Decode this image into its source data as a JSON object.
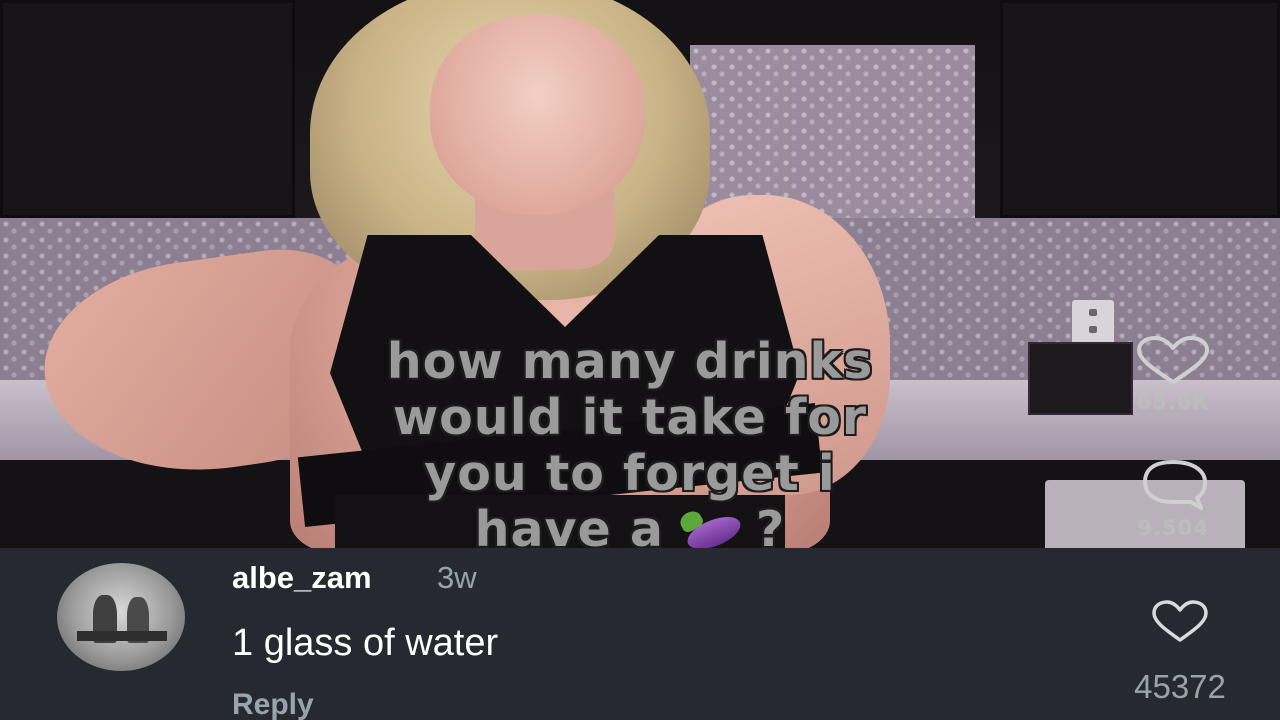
{
  "video": {
    "caption_lines": [
      "how many drinks",
      "would it take for",
      "you to forget i"
    ],
    "caption_last_start": "have a",
    "caption_last_end": "?",
    "caption_emoji": "eggplant-emoji"
  },
  "side_actions": {
    "like_count": "65.6K",
    "comment_count": "9.504"
  },
  "comment": {
    "username": "albe_zam",
    "time_ago": "3w",
    "text": "1 glass of water",
    "reply_label": "Reply",
    "like_count": "45372"
  },
  "colors": {
    "panel_bg": "#262a30",
    "muted_text": "#9aa3ad",
    "caption_fill": "#9a9a9a"
  }
}
